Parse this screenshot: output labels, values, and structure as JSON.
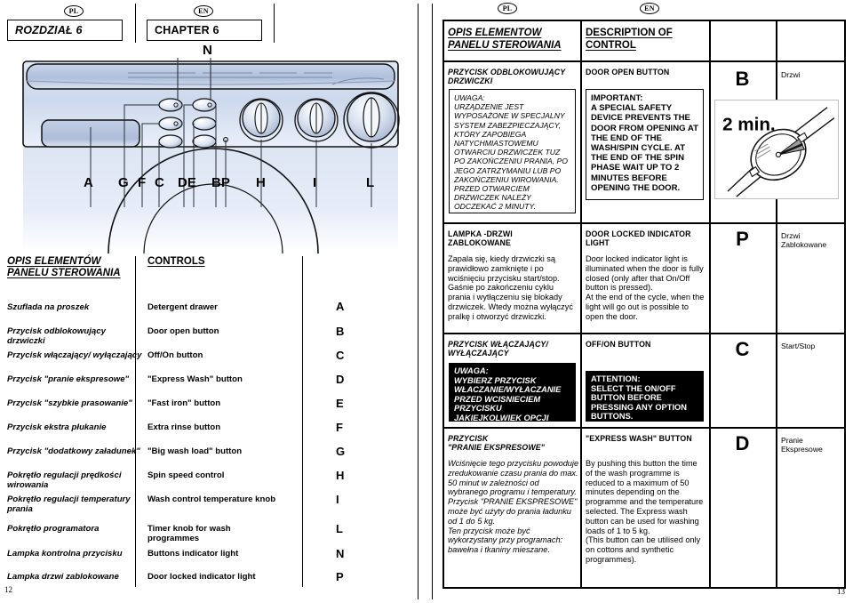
{
  "left": {
    "badge_pl": "PL",
    "badge_en": "EN",
    "chapter_pl": "ROZDZIAŁ 6",
    "chapter_en": "CHAPTER 6",
    "machine_callouts": [
      "A",
      "G",
      "F",
      "C",
      "DE",
      "BP",
      "H",
      "I",
      "L"
    ],
    "machine_top_callout": "N",
    "list_head_pl_l1": "OPIS ELEMENTÓW",
    "list_head_pl_l2": "PANELU STEROWANIA",
    "list_head_en_l1": "CONTROLS",
    "rows": [
      {
        "pl": "Szuflada na proszek",
        "en": "Detergent drawer",
        "letter": "A"
      },
      {
        "pl": "Przycisk odblokowujący drzwiczki",
        "en": "Door open button",
        "letter": "B"
      },
      {
        "pl": "Przycisk włączający/ wyłączający",
        "en": "Off/On button",
        "letter": "C"
      },
      {
        "pl": "Przycisk \"pranie ekspresowe\"",
        "en": "\"Express Wash\" button",
        "letter": "D"
      },
      {
        "pl": "Przycisk \"szybkie prasowanie\"",
        "en": "\"Fast iron\" button",
        "letter": "E"
      },
      {
        "pl": "Przycisk ekstra płukanie",
        "en": "Extra rinse button",
        "letter": "F"
      },
      {
        "pl": "Przycisk \"dodatkowy załadunek\"",
        "en": "\"Big wash load\" button",
        "letter": "G"
      },
      {
        "pl": "Pokrętło regulacji prędkości wirowania",
        "en": "Spin speed control",
        "letter": "H"
      },
      {
        "pl": "Pokrętło regulacji temperatury prania",
        "en": "Wash control temperature knob",
        "letter": "I"
      },
      {
        "pl": "Pokrętło programatora",
        "en": "Timer knob for wash programmes",
        "letter": "L"
      },
      {
        "pl": "Lampka kontrolna przycisku",
        "en": "Buttons indicator light",
        "letter": "N"
      },
      {
        "pl": "Lampka drzwi zablokowane",
        "en": "Door locked indicator light",
        "letter": "P"
      }
    ],
    "page_number": "12"
  },
  "right": {
    "badge_pl": "PL",
    "badge_en": "EN",
    "header_pl_l1": "OPIS ELEMENTÓW",
    "header_pl_l2": "PANELU STEROWANIA",
    "header_en_l1": "DESCRIPTION OF",
    "header_en_l2": "CONTROL",
    "rows": [
      {
        "title_pl_l1": "PRZYCISK ODBLOKOWUJĄCY",
        "title_pl_l2": "DRZWICZKI",
        "title_en": "DOOR OPEN BUTTON",
        "boxed_pl": "UWAGA:\nURZĄDZENIE JEST WYPOSAŻONE W SPECJALNY SYSTEM ZABEZPIECZAJĄCY, KTÓRY ZAPOBIEGA NATYCHMIASTOWEMU OTWARCIU DRZWICZEK TUZ PO ZAKOŃCZENIU PRANIA, PO JEGO ZATRZYMANIU LUB PO ZAKOŃCZENIU WIROWANIA. PRZED OTWARCIEM DRZWICZEK NALEŻY ODCZEKAĆ 2 MINUTY.",
        "boxed_en": "IMPORTANT:\nA SPECIAL SAFETY DEVICE PREVENTS THE DOOR FROM OPENING AT THE END OF THE WASH/SPIN CYCLE. AT THE END OF THE SPIN PHASE WAIT UP TO 2 MINUTES BEFORE OPENING THE DOOR.",
        "letter": "B",
        "side_note": "Drzwi",
        "graphic_label": "2 min.",
        "style": "outline"
      },
      {
        "title_pl_l1": "LAMPKA -DRZWI",
        "title_pl_l2": "ZABLOKOWANE",
        "title_en": "DOOR LOCKED INDICATOR LIGHT",
        "body_pl": "Zapala się, kiedy drzwiczki są prawidłowo zamknięte i po wciśnięciu przycisku start/stop. Gaśnie po zakończeniu cyklu prania i wytłączeniu się blokady drzwiczek. Wtedy można wyłączyć pralkę i otworzyć drzwiczki.",
        "body_en": "Door locked indicator light is illuminated when the door is fully closed (only after that On/Off button is pressed).\nAt the end of the cycle, when the light will go out is possible to open the door.",
        "letter": "P",
        "side_note_l1": "Drzwi",
        "side_note_l2": "Zablokowane",
        "style": "plain"
      },
      {
        "title_pl_l1": "PRZYCISK WŁĄCZAJĄCY/",
        "title_pl_l2": "WYŁĄCZAJĄCY",
        "title_en": "OFF/ON BUTTON",
        "boxed_pl": "UWAGA:\nWYBIERZ PRZYCISK WŁACZANIE/WYŁACZANIE PRZED WCISNIECIEM PRZYCISKU JAKIEJKOLWIEK OPCJI",
        "boxed_en": "ATTENTION:\nSELECT THE ON/OFF BUTTON BEFORE PRESSING ANY OPTION BUTTONS.",
        "letter": "C",
        "side_note": "Start/Stop",
        "style": "inverted"
      },
      {
        "title_pl_l1": "PRZYCISK",
        "title_pl_l2": "\"PRANIE EKSPRESOWE\"",
        "title_en": "\"EXPRESS WASH\" BUTTON",
        "body_pl": "Wciśnięcie tego przycisku powoduje zredukowanie czasu prania do max. 50 minut w zależności od wybranego programu i temperatury. Przycisk \"PRANIE EKSPRESOWE\" może być użyty do prania ładunku od 1 do 5 kg.\nTen przycisk może być wykorzystany przy programach: bawełna i tkaniny mieszane.",
        "body_en": "By pushing this button the time of the wash programme is reduced to a maximum of 50 minutes depending on the programme and the temperature selected. The Express wash button can be used for washing loads of 1 to 5 kg.\n(This button can be utilised only on cottons and synthetic programmes).",
        "letter": "D",
        "side_note_l1": "Pranie",
        "side_note_l2": "Ekspresowe",
        "style": "plain"
      }
    ],
    "page_number": "13"
  },
  "colors": {
    "ink": "#000000",
    "machine_light": "#e9eef7",
    "machine_mid": "#c6d2e6",
    "machine_dark": "#8a9bb8",
    "rule": "#7f8fa8"
  }
}
